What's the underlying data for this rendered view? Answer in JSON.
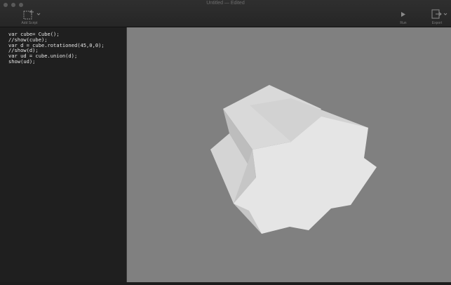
{
  "window": {
    "title": "Untitled — Edited"
  },
  "toolbar": {
    "add_script_label": "Add Script",
    "run_label": "Run",
    "export_label": "Export"
  },
  "icons": {
    "add_script": "add-script-icon",
    "run": "play-icon",
    "export": "export-icon"
  },
  "editor": {
    "lines": [
      "var cube= Cube();",
      "//show(cube);",
      "var d = cube.rotationed(45,0,0);",
      "//show(d);",
      "var ud = cube.union(d);",
      "show(ud);"
    ]
  },
  "colors": {
    "editor_bg": "#1f1f1f",
    "viewport_bg": "#808080",
    "toolbar_bg": "#2b2b2b"
  }
}
